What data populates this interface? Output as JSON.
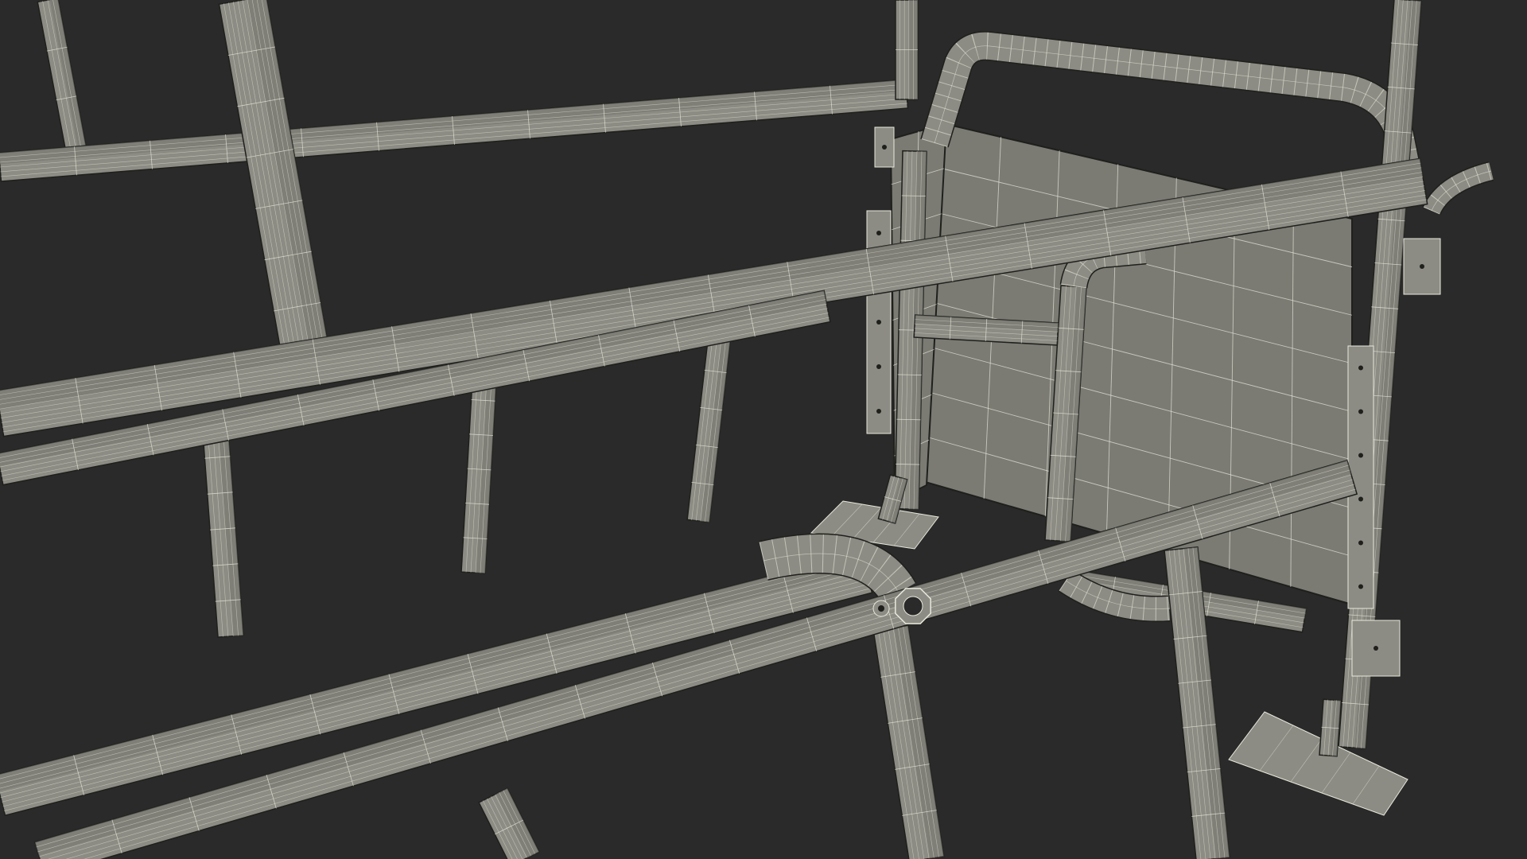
{
  "scene": {
    "subject": "wireframe-render-metal-pen-frame",
    "background_color": "#2a2a2a",
    "tube_color": "#8c8c84",
    "tube_shade_color": "#76766f",
    "panel_color": "#7b7b74",
    "wire_color": "#e8e8dc",
    "outline_color": "#1f1f1c"
  }
}
